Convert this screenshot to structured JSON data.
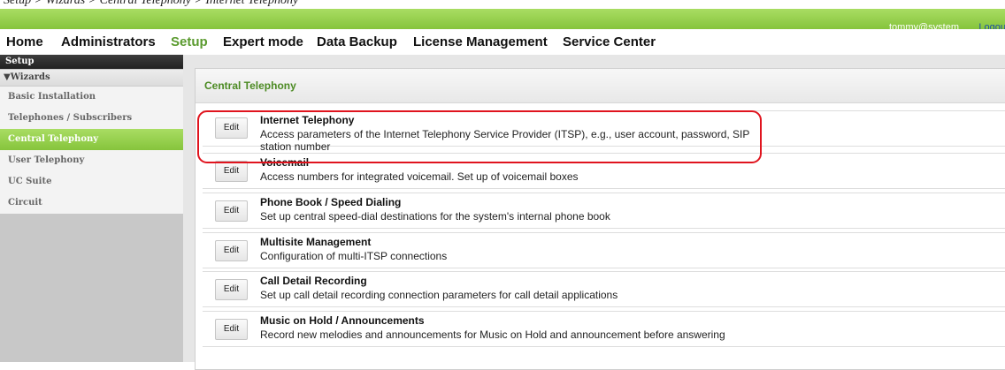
{
  "caption": "Setup > Wizards > Central Telephony > Internet Telephony",
  "header": {
    "user": "tommy@system",
    "logout_label": "Logout"
  },
  "nav": [
    {
      "label": "Home"
    },
    {
      "label": "Administrators"
    },
    {
      "label": "Setup",
      "active": true
    },
    {
      "label": "Expert mode"
    },
    {
      "label": "Data Backup"
    },
    {
      "label": "License Management"
    },
    {
      "label": "Service Center"
    }
  ],
  "sidebar": {
    "header": "Setup",
    "group": "▼Wizards",
    "items": [
      {
        "label": "Basic Installation"
      },
      {
        "label": "Telephones / Subscribers"
      },
      {
        "label": "Central Telephony",
        "active": true
      },
      {
        "label": "User Telephony"
      },
      {
        "label": "UC Suite"
      },
      {
        "label": "Circuit"
      }
    ]
  },
  "main": {
    "title": "Central Telephony",
    "help_icon": "?",
    "rows": [
      {
        "button": "Edit",
        "title": "Internet Telephony",
        "desc": "Access parameters of the Internet Telephony Service Provider (ITSP), e.g., user account, password, SIP station number"
      },
      {
        "button": "Edit",
        "title": "Voicemail",
        "desc": "Access numbers for integrated voicemail. Set up of voicemail boxes"
      },
      {
        "button": "Edit",
        "title": "Phone Book / Speed Dialing",
        "desc": "Set up central speed-dial destinations for the system's internal phone book"
      },
      {
        "button": "Edit",
        "title": "Multisite Management",
        "desc": "Configuration of multi-ITSP connections"
      },
      {
        "button": "Edit",
        "title": "Call Detail Recording",
        "desc": "Set up call detail recording connection parameters for call detail applications"
      },
      {
        "button": "Edit",
        "title": "Music on Hold / Announcements",
        "desc": "Record new melodies and announcements for Music on Hold and announcement before answering"
      }
    ]
  },
  "colors": {
    "accent_green": "#86c43c",
    "title_green": "#4b8a22",
    "highlight_red": "#e0141e"
  }
}
